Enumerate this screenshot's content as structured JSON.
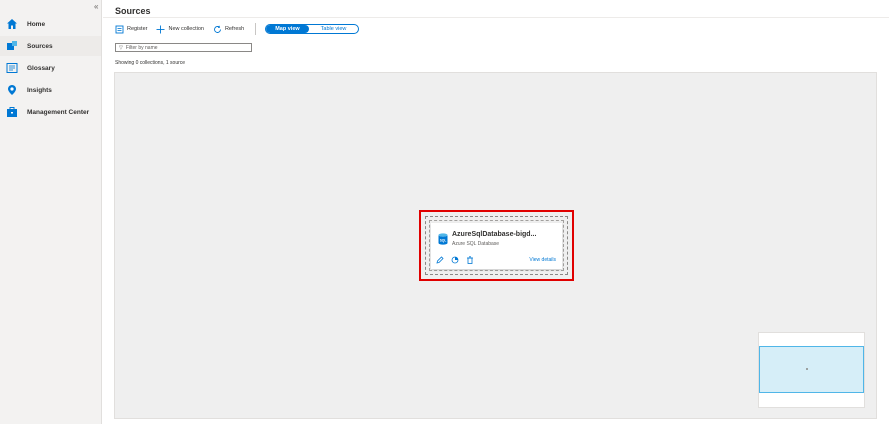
{
  "sidebar": {
    "collapse_glyph": "«",
    "items": [
      {
        "label": "Home",
        "icon": "home-icon"
      },
      {
        "label": "Sources",
        "icon": "sources-icon",
        "active": true
      },
      {
        "label": "Glossary",
        "icon": "glossary-icon"
      },
      {
        "label": "Insights",
        "icon": "insights-icon"
      },
      {
        "label": "Management Center",
        "icon": "management-center-icon"
      }
    ]
  },
  "header": {
    "title": "Sources"
  },
  "toolbar": {
    "register": "Register",
    "new_collection": "New collection",
    "refresh": "Refresh",
    "map_view": "Map view",
    "table_view": "Table view"
  },
  "filter": {
    "placeholder": "Filter by name"
  },
  "status": {
    "showing": "Showing 0 collections, 1 source"
  },
  "source_card": {
    "title": "AzureSqlDatabase-bigd...",
    "subtitle": "Azure SQL Database",
    "view_details": "View details",
    "icon": "sql-database-icon"
  },
  "colors": {
    "accent": "#0078d4",
    "highlight": "#e00000",
    "sidebar_bg": "#f3f2f1",
    "canvas_bg": "#efefef"
  }
}
